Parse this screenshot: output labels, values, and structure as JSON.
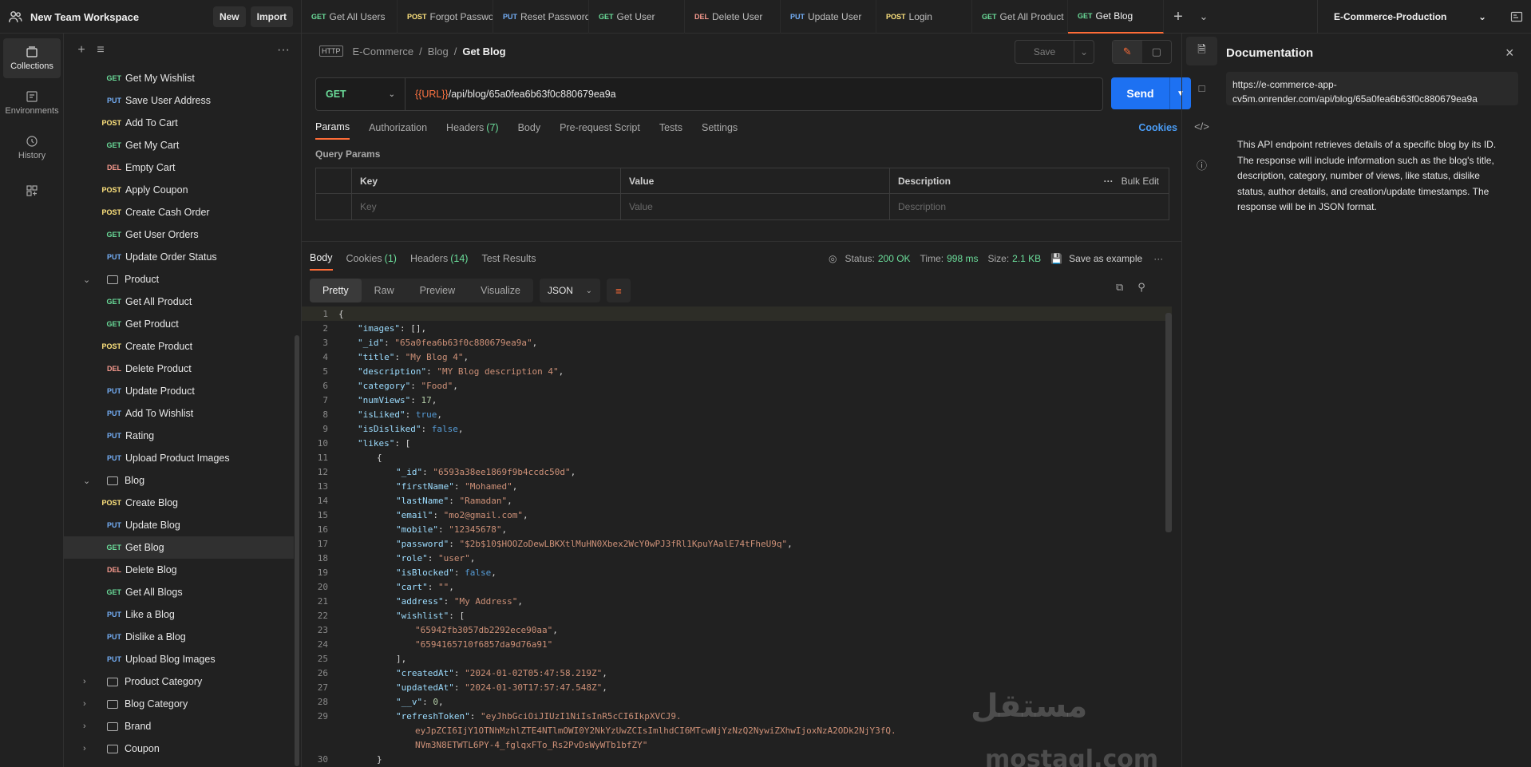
{
  "workspace": {
    "name": "New Team Workspace",
    "new_label": "New",
    "import_label": "Import"
  },
  "tabs": [
    {
      "method": "GET",
      "label": "Get All Users",
      "active": false
    },
    {
      "method": "POST",
      "label": "Forgot Password",
      "active": false
    },
    {
      "method": "PUT",
      "label": "Reset Password",
      "active": false
    },
    {
      "method": "GET",
      "label": "Get User",
      "active": false
    },
    {
      "method": "DEL",
      "label": "Delete User",
      "active": false
    },
    {
      "method": "PUT",
      "label": "Update User",
      "active": false
    },
    {
      "method": "POST",
      "label": "Login",
      "active": false
    },
    {
      "method": "GET",
      "label": "Get All Product",
      "active": false
    },
    {
      "method": "GET",
      "label": "Get Blog",
      "active": true
    }
  ],
  "environment": {
    "name": "E-Commerce-Production"
  },
  "rail": [
    {
      "label": "Collections",
      "icon": "collections-icon",
      "active": true
    },
    {
      "label": "Environments",
      "icon": "environments-icon",
      "active": false
    },
    {
      "label": "History",
      "icon": "history-icon",
      "active": false
    },
    {
      "label": "",
      "icon": "apps-icon",
      "active": false
    }
  ],
  "tree": [
    {
      "type": "req",
      "method": "GET",
      "label": "Get My Wishlist"
    },
    {
      "type": "req",
      "method": "PUT",
      "label": "Save User Address"
    },
    {
      "type": "req",
      "method": "POST",
      "label": "Add To Cart"
    },
    {
      "type": "req",
      "method": "GET",
      "label": "Get My Cart"
    },
    {
      "type": "req",
      "method": "DEL",
      "label": "Empty Cart"
    },
    {
      "type": "req",
      "method": "POST",
      "label": "Apply Coupon"
    },
    {
      "type": "req",
      "method": "POST",
      "label": "Create Cash Order"
    },
    {
      "type": "req",
      "method": "GET",
      "label": "Get User Orders"
    },
    {
      "type": "req",
      "method": "PUT",
      "label": "Update Order Status"
    },
    {
      "type": "folder",
      "open": true,
      "label": "Product"
    },
    {
      "type": "req",
      "method": "GET",
      "label": "Get All Product"
    },
    {
      "type": "req",
      "method": "GET",
      "label": "Get Product"
    },
    {
      "type": "req",
      "method": "POST",
      "label": "Create Product"
    },
    {
      "type": "req",
      "method": "DEL",
      "label": "Delete Product"
    },
    {
      "type": "req",
      "method": "PUT",
      "label": "Update Product"
    },
    {
      "type": "req",
      "method": "PUT",
      "label": "Add To Wishlist"
    },
    {
      "type": "req",
      "method": "PUT",
      "label": "Rating"
    },
    {
      "type": "req",
      "method": "PUT",
      "label": "Upload Product Images"
    },
    {
      "type": "folder",
      "open": true,
      "label": "Blog"
    },
    {
      "type": "req",
      "method": "POST",
      "label": "Create Blog"
    },
    {
      "type": "req",
      "method": "PUT",
      "label": "Update Blog"
    },
    {
      "type": "req",
      "method": "GET",
      "label": "Get Blog",
      "selected": true
    },
    {
      "type": "req",
      "method": "DEL",
      "label": "Delete Blog"
    },
    {
      "type": "req",
      "method": "GET",
      "label": "Get All Blogs"
    },
    {
      "type": "req",
      "method": "PUT",
      "label": "Like a Blog"
    },
    {
      "type": "req",
      "method": "PUT",
      "label": "Dislike a Blog"
    },
    {
      "type": "req",
      "method": "PUT",
      "label": "Upload Blog Images"
    },
    {
      "type": "folder",
      "open": false,
      "label": "Product Category"
    },
    {
      "type": "folder",
      "open": false,
      "label": "Blog Category"
    },
    {
      "type": "folder",
      "open": false,
      "label": "Brand"
    },
    {
      "type": "folder",
      "open": false,
      "label": "Coupon"
    }
  ],
  "breadcrumb": {
    "badge": "HTTP",
    "items": [
      "E-Commerce",
      "Blog"
    ],
    "current": "Get Blog"
  },
  "save_label": "Save",
  "request": {
    "method": "GET",
    "url_var": "{{URL}}",
    "url_path": "/api/blog/65a0fea6b63f0c880679ea9a",
    "send_label": "Send"
  },
  "request_tabs": [
    {
      "label": "Params",
      "count": "",
      "active": true
    },
    {
      "label": "Authorization",
      "count": "",
      "active": false
    },
    {
      "label": "Headers",
      "count": "(7)",
      "active": false
    },
    {
      "label": "Body",
      "count": "",
      "active": false
    },
    {
      "label": "Pre-request Script",
      "count": "",
      "active": false
    },
    {
      "label": "Tests",
      "count": "",
      "active": false
    },
    {
      "label": "Settings",
      "count": "",
      "active": false
    }
  ],
  "cookies_label": "Cookies",
  "query_params": {
    "title": "Query Params",
    "headers": {
      "key": "Key",
      "value": "Value",
      "description": "Description",
      "bulk_edit": "Bulk Edit"
    },
    "placeholders": {
      "key": "Key",
      "value": "Value",
      "description": "Description"
    }
  },
  "response_tabs": [
    {
      "label": "Body",
      "count": "",
      "active": true
    },
    {
      "label": "Cookies",
      "count": "(1)",
      "active": false
    },
    {
      "label": "Headers",
      "count": "(14)",
      "active": false
    },
    {
      "label": "Test Results",
      "count": "",
      "active": false
    }
  ],
  "response_status": {
    "status_label": "Status:",
    "status": "200 OK",
    "time_label": "Time:",
    "time": "998 ms",
    "size_label": "Size:",
    "size": "2.1 KB",
    "save_example": "Save as example"
  },
  "format_modes": [
    "Pretty",
    "Raw",
    "Preview",
    "Visualize"
  ],
  "format_active": "Pretty",
  "format_lang": "JSON",
  "code_lines": [
    {
      "no": "1",
      "indent": 0,
      "tokens": [
        [
          "p",
          "{"
        ]
      ]
    },
    {
      "no": "2",
      "indent": 1,
      "tokens": [
        [
          "k",
          "\"images\""
        ],
        [
          "p",
          ": [],"
        ]
      ]
    },
    {
      "no": "3",
      "indent": 1,
      "tokens": [
        [
          "k",
          "\"_id\""
        ],
        [
          "p",
          ": "
        ],
        [
          "s",
          "\"65a0fea6b63f0c880679ea9a\""
        ],
        [
          "p",
          ","
        ]
      ]
    },
    {
      "no": "4",
      "indent": 1,
      "tokens": [
        [
          "k",
          "\"title\""
        ],
        [
          "p",
          ": "
        ],
        [
          "s",
          "\"My Blog 4\""
        ],
        [
          "p",
          ","
        ]
      ]
    },
    {
      "no": "5",
      "indent": 1,
      "tokens": [
        [
          "k",
          "\"description\""
        ],
        [
          "p",
          ": "
        ],
        [
          "s",
          "\"MY Blog description 4\""
        ],
        [
          "p",
          ","
        ]
      ]
    },
    {
      "no": "6",
      "indent": 1,
      "tokens": [
        [
          "k",
          "\"category\""
        ],
        [
          "p",
          ": "
        ],
        [
          "s",
          "\"Food\""
        ],
        [
          "p",
          ","
        ]
      ]
    },
    {
      "no": "7",
      "indent": 1,
      "tokens": [
        [
          "k",
          "\"numViews\""
        ],
        [
          "p",
          ": "
        ],
        [
          "n",
          "17"
        ],
        [
          "p",
          ","
        ]
      ]
    },
    {
      "no": "8",
      "indent": 1,
      "tokens": [
        [
          "k",
          "\"isLiked\""
        ],
        [
          "p",
          ": "
        ],
        [
          "b",
          "true"
        ],
        [
          "p",
          ","
        ]
      ]
    },
    {
      "no": "9",
      "indent": 1,
      "tokens": [
        [
          "k",
          "\"isDisliked\""
        ],
        [
          "p",
          ": "
        ],
        [
          "b",
          "false"
        ],
        [
          "p",
          ","
        ]
      ]
    },
    {
      "no": "10",
      "indent": 1,
      "tokens": [
        [
          "k",
          "\"likes\""
        ],
        [
          "p",
          ": ["
        ]
      ]
    },
    {
      "no": "11",
      "indent": 2,
      "tokens": [
        [
          "p",
          "{"
        ]
      ]
    },
    {
      "no": "12",
      "indent": 3,
      "tokens": [
        [
          "k",
          "\"_id\""
        ],
        [
          "p",
          ": "
        ],
        [
          "s",
          "\"6593a38ee1869f9b4ccdc50d\""
        ],
        [
          "p",
          ","
        ]
      ]
    },
    {
      "no": "13",
      "indent": 3,
      "tokens": [
        [
          "k",
          "\"firstName\""
        ],
        [
          "p",
          ": "
        ],
        [
          "s",
          "\"Mohamed\""
        ],
        [
          "p",
          ","
        ]
      ]
    },
    {
      "no": "14",
      "indent": 3,
      "tokens": [
        [
          "k",
          "\"lastName\""
        ],
        [
          "p",
          ": "
        ],
        [
          "s",
          "\"Ramadan\""
        ],
        [
          "p",
          ","
        ]
      ]
    },
    {
      "no": "15",
      "indent": 3,
      "tokens": [
        [
          "k",
          "\"email\""
        ],
        [
          "p",
          ": "
        ],
        [
          "s",
          "\"mo2@gmail.com\""
        ],
        [
          "p",
          ","
        ]
      ]
    },
    {
      "no": "16",
      "indent": 3,
      "tokens": [
        [
          "k",
          "\"mobile\""
        ],
        [
          "p",
          ": "
        ],
        [
          "s",
          "\"12345678\""
        ],
        [
          "p",
          ","
        ]
      ]
    },
    {
      "no": "17",
      "indent": 3,
      "tokens": [
        [
          "k",
          "\"password\""
        ],
        [
          "p",
          ": "
        ],
        [
          "s",
          "\"$2b$10$HOOZoDewLBKXtlMuHN0Xbex2WcY0wPJ3fRl1KpuYAalE74tFheU9q\""
        ],
        [
          "p",
          ","
        ]
      ]
    },
    {
      "no": "18",
      "indent": 3,
      "tokens": [
        [
          "k",
          "\"role\""
        ],
        [
          "p",
          ": "
        ],
        [
          "s",
          "\"user\""
        ],
        [
          "p",
          ","
        ]
      ]
    },
    {
      "no": "19",
      "indent": 3,
      "tokens": [
        [
          "k",
          "\"isBlocked\""
        ],
        [
          "p",
          ": "
        ],
        [
          "b",
          "false"
        ],
        [
          "p",
          ","
        ]
      ]
    },
    {
      "no": "20",
      "indent": 3,
      "tokens": [
        [
          "k",
          "\"cart\""
        ],
        [
          "p",
          ": "
        ],
        [
          "s",
          "\"\""
        ],
        [
          "p",
          ","
        ]
      ]
    },
    {
      "no": "21",
      "indent": 3,
      "tokens": [
        [
          "k",
          "\"address\""
        ],
        [
          "p",
          ": "
        ],
        [
          "s",
          "\"My Address\""
        ],
        [
          "p",
          ","
        ]
      ]
    },
    {
      "no": "22",
      "indent": 3,
      "tokens": [
        [
          "k",
          "\"wishlist\""
        ],
        [
          "p",
          ": ["
        ]
      ]
    },
    {
      "no": "23",
      "indent": 4,
      "tokens": [
        [
          "s",
          "\"65942fb3057db2292ece90aa\""
        ],
        [
          "p",
          ","
        ]
      ]
    },
    {
      "no": "24",
      "indent": 4,
      "tokens": [
        [
          "s",
          "\"6594165710f6857da9d76a91\""
        ]
      ]
    },
    {
      "no": "25",
      "indent": 3,
      "tokens": [
        [
          "p",
          "],"
        ]
      ]
    },
    {
      "no": "26",
      "indent": 3,
      "tokens": [
        [
          "k",
          "\"createdAt\""
        ],
        [
          "p",
          ": "
        ],
        [
          "s",
          "\"2024-01-02T05:47:58.219Z\""
        ],
        [
          "p",
          ","
        ]
      ]
    },
    {
      "no": "27",
      "indent": 3,
      "tokens": [
        [
          "k",
          "\"updatedAt\""
        ],
        [
          "p",
          ": "
        ],
        [
          "s",
          "\"2024-01-30T17:57:47.548Z\""
        ],
        [
          "p",
          ","
        ]
      ]
    },
    {
      "no": "28",
      "indent": 3,
      "tokens": [
        [
          "k",
          "\"__v\""
        ],
        [
          "p",
          ": "
        ],
        [
          "n",
          "0"
        ],
        [
          "p",
          ","
        ]
      ]
    },
    {
      "no": "29",
      "indent": 3,
      "tokens": [
        [
          "k",
          "\"refreshToken\""
        ],
        [
          "p",
          ": "
        ],
        [
          "s",
          "\"eyJhbGciOiJIUzI1NiIsInR5cCI6IkpXVCJ9."
        ]
      ]
    },
    {
      "no": "",
      "indent": 4,
      "tokens": [
        [
          "s",
          "eyJpZCI6IjY1OTNhMzhlZTE4NTlmOWI0Y2NkYzUwZCIsImlhdCI6MTcwNjYzNzQ2NywiZXhwIjoxNzA2ODk2NjY3fQ."
        ]
      ]
    },
    {
      "no": "",
      "indent": 4,
      "tokens": [
        [
          "s",
          "NVm3N8ETWTL6PY-4_fglqxFTo_Rs2PvDsWyWTb1bfZY\""
        ]
      ]
    },
    {
      "no": "30",
      "indent": 2,
      "tokens": [
        [
          "p",
          "}"
        ]
      ]
    }
  ],
  "documentation": {
    "title": "Documentation",
    "url": "https://e-commerce-app-cv5m.onrender.com/api/blog/65a0fea6b63f0c880679ea9a",
    "description": "This API endpoint retrieves details of a specific blog by its ID. The response will include information such as the blog's title, description, category, number of views, like status, dislike status, author details, and creation/update timestamps. The response will be in JSON format."
  },
  "watermark": {
    "arabic": "مستقل",
    "latin": "mostaql.com"
  },
  "colors": {
    "accent": "#ff6c37",
    "send": "#1d71f2",
    "get": "#6bdd9a",
    "post": "#ffe47e",
    "put": "#74aef6",
    "del": "#f79a8e"
  }
}
